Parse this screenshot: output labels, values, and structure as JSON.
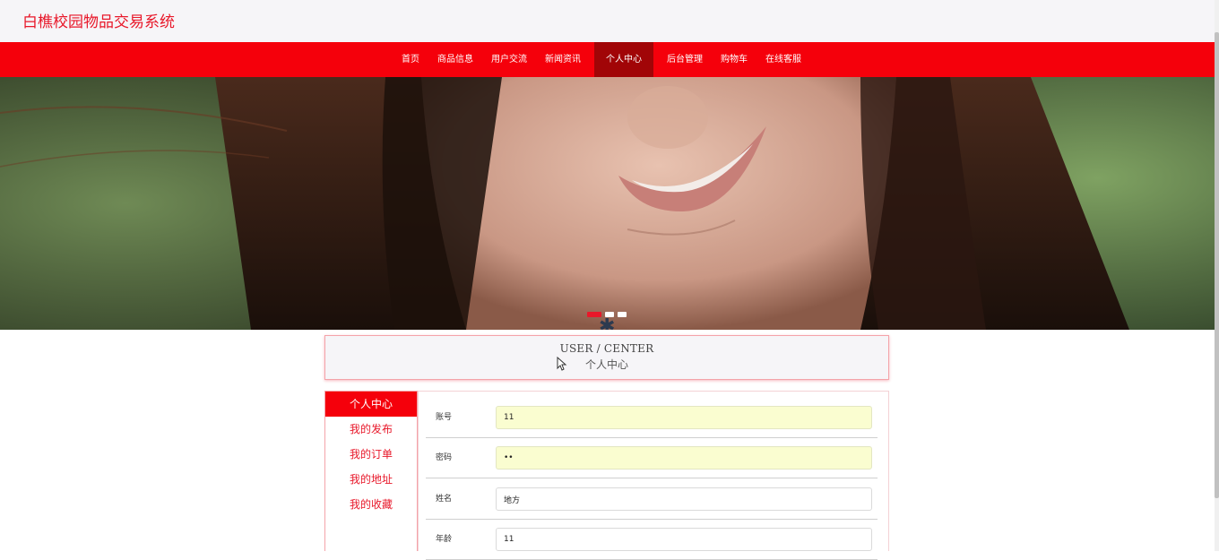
{
  "site": {
    "title": "白樵校园物品交易系统"
  },
  "nav": {
    "items": [
      {
        "label": "首页",
        "active": false
      },
      {
        "label": "商品信息",
        "active": false
      },
      {
        "label": "用户交流",
        "active": false
      },
      {
        "label": "新闻资讯",
        "active": false
      },
      {
        "label": "个人中心",
        "active": true
      },
      {
        "label": "后台管理",
        "active": false
      },
      {
        "label": "购物车",
        "active": false
      },
      {
        "label": "在线客服",
        "active": false
      }
    ]
  },
  "banner": {
    "slide_count": 3,
    "active_slide": 1
  },
  "section": {
    "title_en": "USER / CENTER",
    "title_cn": "个人中心"
  },
  "sidebar": {
    "items": [
      {
        "label": "个人中心",
        "active": true
      },
      {
        "label": "我的发布",
        "active": false
      },
      {
        "label": "我的订单",
        "active": false
      },
      {
        "label": "我的地址",
        "active": false
      },
      {
        "label": "我的收藏",
        "active": false
      }
    ]
  },
  "form": {
    "fields": [
      {
        "label": "账号",
        "value": "11",
        "type": "text",
        "autofill": true
      },
      {
        "label": "密码",
        "value": "11",
        "type": "password",
        "autofill": true
      },
      {
        "label": "姓名",
        "value": "地方",
        "type": "text",
        "autofill": false
      },
      {
        "label": "年龄",
        "value": "11",
        "type": "text",
        "autofill": false
      }
    ]
  },
  "colors": {
    "brand_red": "#f5000b",
    "active_nav": "#a10507",
    "title_red": "#e8182a",
    "autofill": "#fafdd0"
  }
}
